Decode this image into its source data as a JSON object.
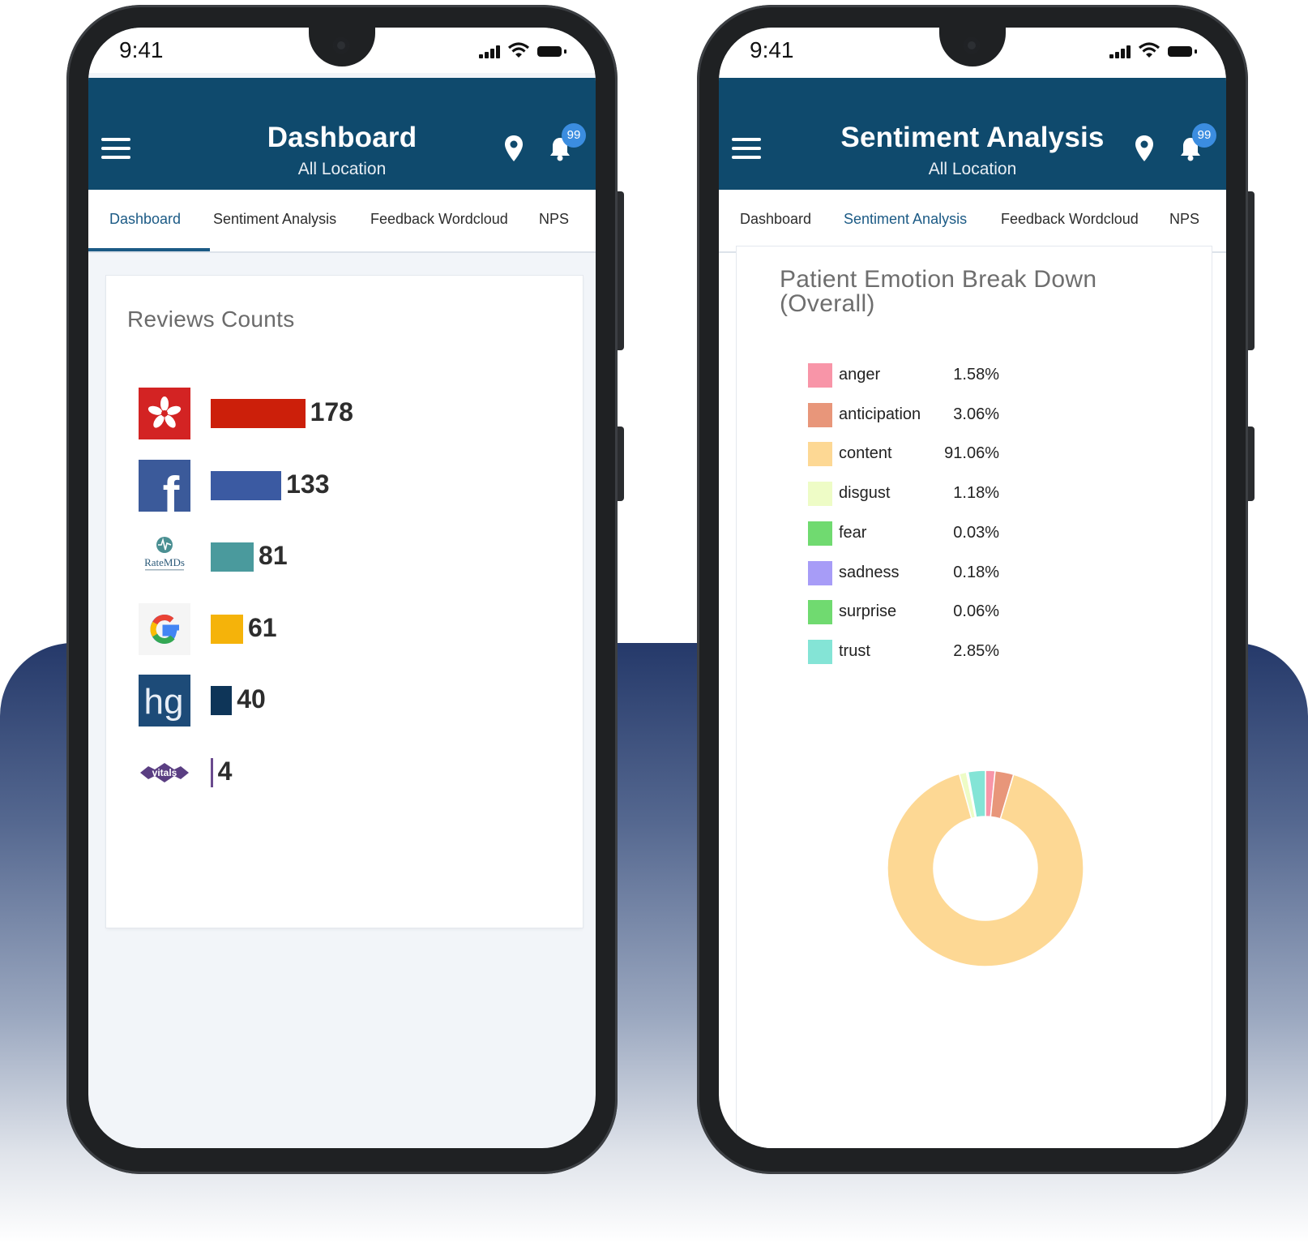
{
  "status": {
    "time": "9:41"
  },
  "left_screen": {
    "app_title": "Dashboard",
    "app_subtitle": "All Location",
    "notification_count": "99",
    "tabs": [
      {
        "label": "Dashboard",
        "active": true
      },
      {
        "label": "Sentiment Analysis",
        "active": false
      },
      {
        "label": "Feedback Wordcloud",
        "active": false
      },
      {
        "label": "NPS",
        "active": false
      }
    ],
    "card_title": "Reviews Counts"
  },
  "right_screen": {
    "app_title": "Sentiment Analysis",
    "app_subtitle": "All Location",
    "notification_count": "99",
    "tabs": [
      {
        "label": "Dashboard",
        "active": false
      },
      {
        "label": "Sentiment Analysis",
        "active": true
      },
      {
        "label": "Feedback Wordcloud",
        "active": false
      },
      {
        "label": "NPS",
        "active": false
      }
    ]
  },
  "chart_data": [
    {
      "type": "bar",
      "title": "Reviews Counts",
      "orientation": "horizontal",
      "categories": [
        "Yelp",
        "Facebook",
        "RateMDs",
        "Google",
        "Healthgrades",
        "Vitals"
      ],
      "values": [
        178,
        133,
        81,
        61,
        40,
        4
      ],
      "colors": [
        "#cc1f0a",
        "#3b5aa2",
        "#4a9a9d",
        "#f5b30a",
        "#0e3558",
        "#6a4a8e"
      ],
      "icons": [
        "yelp-logo",
        "facebook-logo",
        "ratemds-logo",
        "google-logo",
        "healthgrades-logo",
        "vitals-logo"
      ],
      "icon_texts": [
        "",
        "f",
        "RateMDs",
        "G",
        "hg",
        "vitals"
      ]
    },
    {
      "type": "pie",
      "subtype": "donut",
      "title": "Patient Emotion Break Down (Overall)",
      "categories": [
        "anger",
        "anticipation",
        "content",
        "disgust",
        "fear",
        "sadness",
        "surprise",
        "trust"
      ],
      "values": [
        1.58,
        3.06,
        91.06,
        1.18,
        0.03,
        0.18,
        0.06,
        2.85
      ],
      "labels": [
        "1.58%",
        "3.06%",
        "91.06%",
        "1.18%",
        "0.03%",
        "0.18%",
        "0.06%",
        "2.85%"
      ],
      "colors": [
        "#f895a8",
        "#e8967a",
        "#fdd894",
        "#eefcc6",
        "#70da70",
        "#a79cf7",
        "#70da70",
        "#84e4d6"
      ]
    }
  ]
}
